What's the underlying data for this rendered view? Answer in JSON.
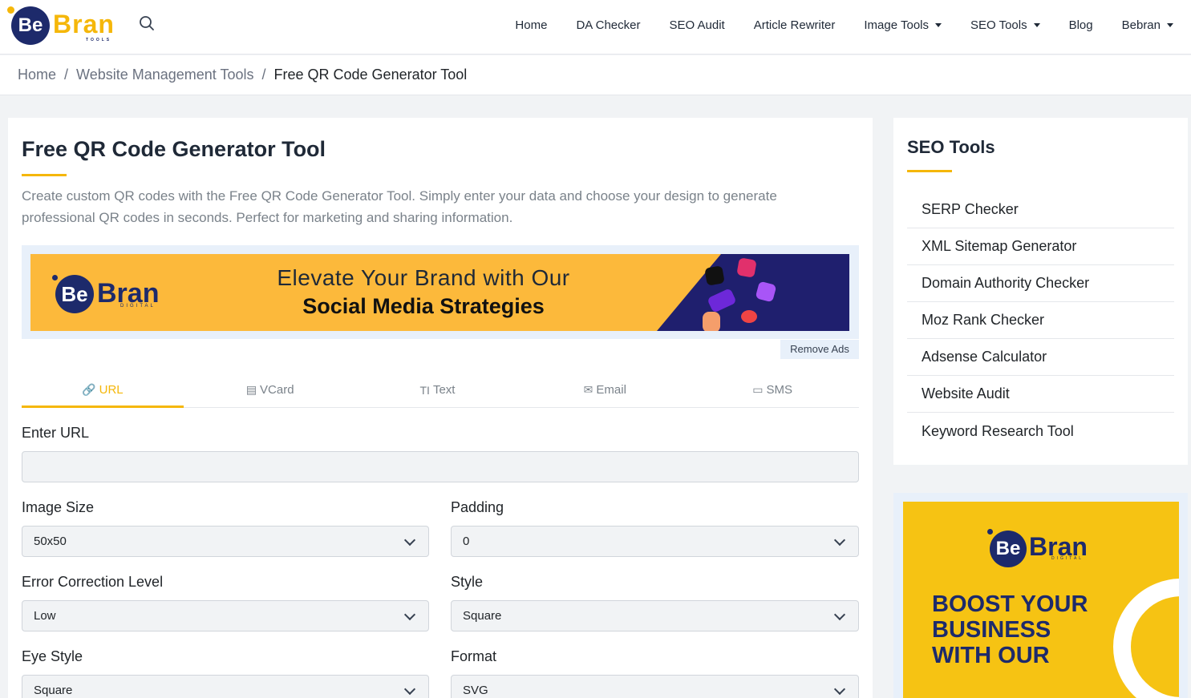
{
  "brand": {
    "logo_mark": "Be",
    "logo_word": "Bran",
    "logo_sub": "TOOLS"
  },
  "nav": {
    "items": [
      {
        "label": "Home",
        "dropdown": false
      },
      {
        "label": "DA Checker",
        "dropdown": false
      },
      {
        "label": "SEO Audit",
        "dropdown": false
      },
      {
        "label": "Article Rewriter",
        "dropdown": false
      },
      {
        "label": "Image Tools",
        "dropdown": true
      },
      {
        "label": "SEO Tools",
        "dropdown": true
      },
      {
        "label": "Blog",
        "dropdown": false
      },
      {
        "label": "Bebran",
        "dropdown": true
      }
    ]
  },
  "breadcrumb": {
    "items": [
      "Home",
      "Website Management Tools",
      "Free QR Code Generator Tool"
    ],
    "separator": "/"
  },
  "main": {
    "title": "Free QR Code Generator Tool",
    "description": "Create custom QR codes with the Free QR Code Generator Tool. Simply enter your data and choose your design to generate professional QR codes in seconds. Perfect for marketing and sharing information.",
    "ad": {
      "logo_mark": "Be",
      "logo_word": "Bran",
      "logo_sub": "DIGITAL",
      "line1": "Elevate Your Brand with Our",
      "line2": "Social Media Strategies",
      "remove_label": "Remove Ads"
    },
    "tabs": [
      {
        "label": "URL",
        "icon": "link-icon",
        "glyph": "🔗",
        "active": true
      },
      {
        "label": "VCard",
        "icon": "vcard-icon",
        "glyph": "▤",
        "active": false
      },
      {
        "label": "Text",
        "icon": "text-icon",
        "glyph": "TI",
        "active": false
      },
      {
        "label": "Email",
        "icon": "email-icon",
        "glyph": "✉",
        "active": false
      },
      {
        "label": "SMS",
        "icon": "sms-icon",
        "glyph": "▭",
        "active": false
      }
    ],
    "form": {
      "url_label": "Enter URL",
      "url_value": "",
      "image_size_label": "Image Size",
      "image_size_value": "50x50",
      "padding_label": "Padding",
      "padding_value": "0",
      "error_label": "Error Correction Level",
      "error_value": "Low",
      "style_label": "Style",
      "style_value": "Square",
      "eye_style_label": "Eye Style",
      "eye_style_value": "Square",
      "format_label": "Format",
      "format_value": "SVG"
    }
  },
  "sidebar": {
    "title": "SEO Tools",
    "items": [
      "SERP Checker",
      "XML Sitemap Generator",
      "Domain Authority Checker",
      "Moz Rank Checker",
      "Adsense Calculator",
      "Website Audit",
      "Keyword Research Tool"
    ],
    "ad": {
      "logo_mark": "Be",
      "logo_word": "Bran",
      "logo_sub": "DIGITAL",
      "text": "BOOST YOUR BUSINESS WITH OUR"
    }
  },
  "colors": {
    "accent": "#f5b70a",
    "navy": "#1d2a6b",
    "ad_orange": "#fcb93b",
    "ad_yellow": "#f6c313"
  }
}
